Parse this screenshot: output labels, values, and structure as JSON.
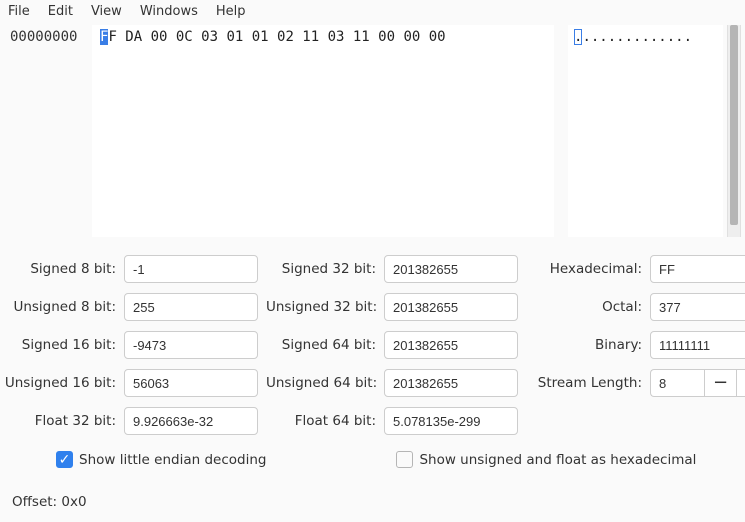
{
  "menu": {
    "items": [
      "File",
      "Edit",
      "View",
      "Windows",
      "Help"
    ]
  },
  "hex": {
    "gutter_0": "00000000",
    "sel_nibble": "F",
    "rest_bytes": "F DA 00 0C 03 01 01 02 11 03 11 00 00 00",
    "ascii_sel": ".",
    "ascii_rest": "............."
  },
  "decode": {
    "labels": {
      "s8": "Signed 8 bit:",
      "u8": "Unsigned 8 bit:",
      "s16": "Signed 16 bit:",
      "u16": "Unsigned 16 bit:",
      "f32": "Float 32 bit:",
      "s32": "Signed 32 bit:",
      "u32": "Unsigned 32 bit:",
      "s64": "Signed 64 bit:",
      "u64": "Unsigned 64 bit:",
      "f64": "Float 64 bit:",
      "hex": "Hexadecimal:",
      "oct": "Octal:",
      "bin": "Binary:",
      "stream": "Stream Length:"
    },
    "values": {
      "s8": "-1",
      "u8": "255",
      "s16": "-9473",
      "u16": "56063",
      "f32": "9.926663e-32",
      "s32": "201382655",
      "u32": "201382655",
      "s64": "201382655",
      "u64": "201382655",
      "f64": "5.078135e-299",
      "hex": "FF",
      "oct": "377",
      "bin": "11111111",
      "stream": "8"
    }
  },
  "checkboxes": {
    "little_endian": {
      "label": "Show little endian decoding",
      "checked": true
    },
    "uf_hex": {
      "label": "Show unsigned and float as hexadecimal",
      "checked": false
    }
  },
  "offset": {
    "label": "Offset:",
    "value": "0x0"
  }
}
